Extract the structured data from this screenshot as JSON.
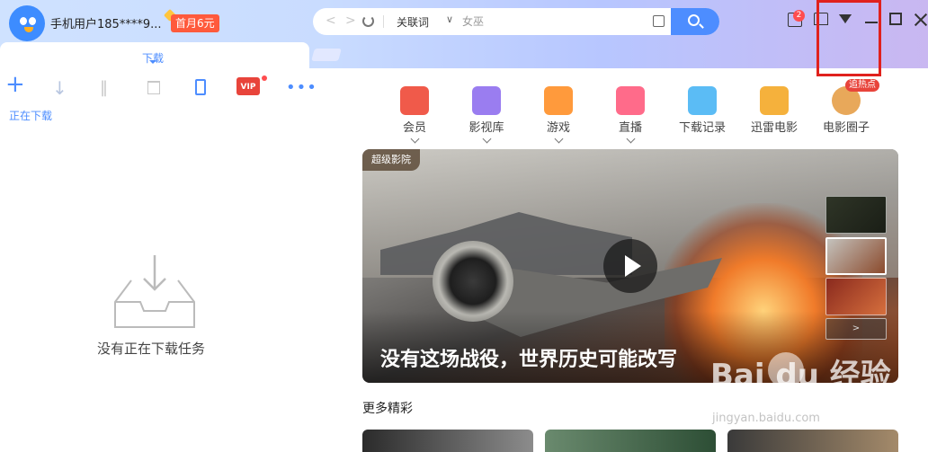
{
  "header": {
    "username": "手机用户185****9...",
    "promo": "首月6元",
    "search": {
      "keyword_label": "关联词",
      "placeholder": "女巫"
    },
    "message_count": "2"
  },
  "download_panel": {
    "tab_label": "下载",
    "status_label": "正在下载",
    "toolbar": {
      "add": "+",
      "download": "↓",
      "pause": "‖",
      "vip": "VIP",
      "more": "•••"
    },
    "empty_text": "没有正在下载任务"
  },
  "nav": {
    "items": [
      {
        "label": "会员",
        "color": "#f05a4a"
      },
      {
        "label": "影视库",
        "color": "#9a7df0"
      },
      {
        "label": "游戏",
        "color": "#ff9a3c"
      },
      {
        "label": "直播",
        "color": "#ff6b8a"
      },
      {
        "label": "下载记录",
        "color": "#5bbcf5"
      },
      {
        "label": "迅雷电影",
        "color": "#f5b13c"
      },
      {
        "label": "电影圈子",
        "color": "#e8a85a"
      }
    ],
    "hot_badge": "追热点"
  },
  "banner": {
    "tag": "超级影院",
    "title": "没有这场战役，世界历史可能改写",
    "next": ">"
  },
  "more_section": {
    "title": "更多精彩"
  },
  "watermark": {
    "text": "Bai  du 经验",
    "sub": "jingyan.baidu.com"
  },
  "colors": {
    "accent": "#4d8dff",
    "highlight": "#e0211d"
  }
}
